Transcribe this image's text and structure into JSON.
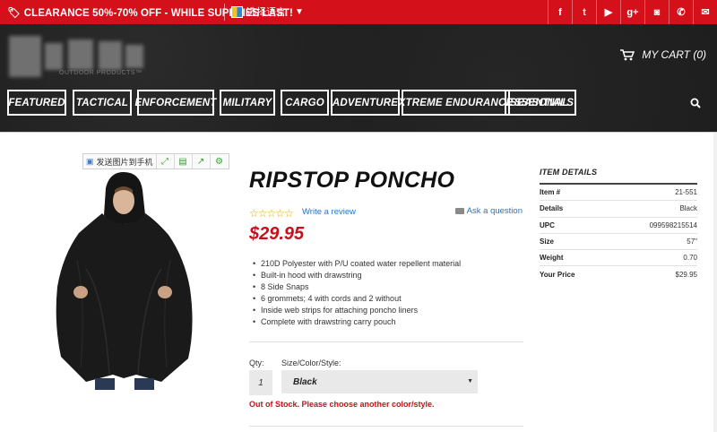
{
  "topbar": {
    "promo": "CLEARANCE 50%-70% OFF - WHILE SUPPLIES LAST!",
    "language": "选择语言",
    "social_icons": [
      "facebook-icon",
      "twitter-icon",
      "youtube-icon",
      "google-plus-icon",
      "instagram-icon",
      "phone-icon",
      "email-icon"
    ],
    "social_glyphs": [
      "f",
      "t",
      "▶",
      "g+",
      "◙",
      "✆",
      "✉"
    ]
  },
  "header": {
    "logo_sub": "OUTDOOR PRODUCTS™",
    "cart": "MY CART (0)"
  },
  "nav": {
    "items": [
      "FEATURED",
      "TACTICAL",
      "ENFORCEMENT",
      "MILITARY",
      "CARGO",
      "ADVENTURE",
      "XTREME ENDURANCE",
      "SEASONAL",
      "ESSENTIALS"
    ]
  },
  "toolbar": {
    "send_label": "发送图片到手机"
  },
  "product": {
    "title": "RIPSTOP PONCHO",
    "stars": "☆☆☆☆☆",
    "write_review": "Write a review",
    "ask_question": "Ask a question",
    "price": "$29.95",
    "features": [
      "210D Polyester with P/U coated water repellent material",
      "Built-in hood with drawstring",
      "8 Side Snaps",
      "6 grommets; 4 with cords and 2 without",
      "Inside web strips for attaching poncho liners",
      "Complete with drawstring carry pouch"
    ],
    "qty_label": "Qty:",
    "qty_value": "1",
    "option_label": "Size/Color/Style:",
    "option_value": "Black",
    "out_of_stock": "Out of Stock. Please choose another color/style."
  },
  "details": {
    "heading": "ITEM DETAILS",
    "rows": [
      {
        "k": "Item #",
        "v": "21-551"
      },
      {
        "k": "Details",
        "v": "Black"
      },
      {
        "k": "UPC",
        "v": "099598215514"
      },
      {
        "k": "Size",
        "v": "57\""
      },
      {
        "k": "Weight",
        "v": "0.70"
      },
      {
        "k": "Your Price",
        "v": "$29.95"
      }
    ]
  },
  "colors": {
    "brand_red": "#d4101b",
    "price_red": "#c8101b",
    "link_blue": "#2f73b5",
    "header_dark": "#1e1e1e"
  }
}
